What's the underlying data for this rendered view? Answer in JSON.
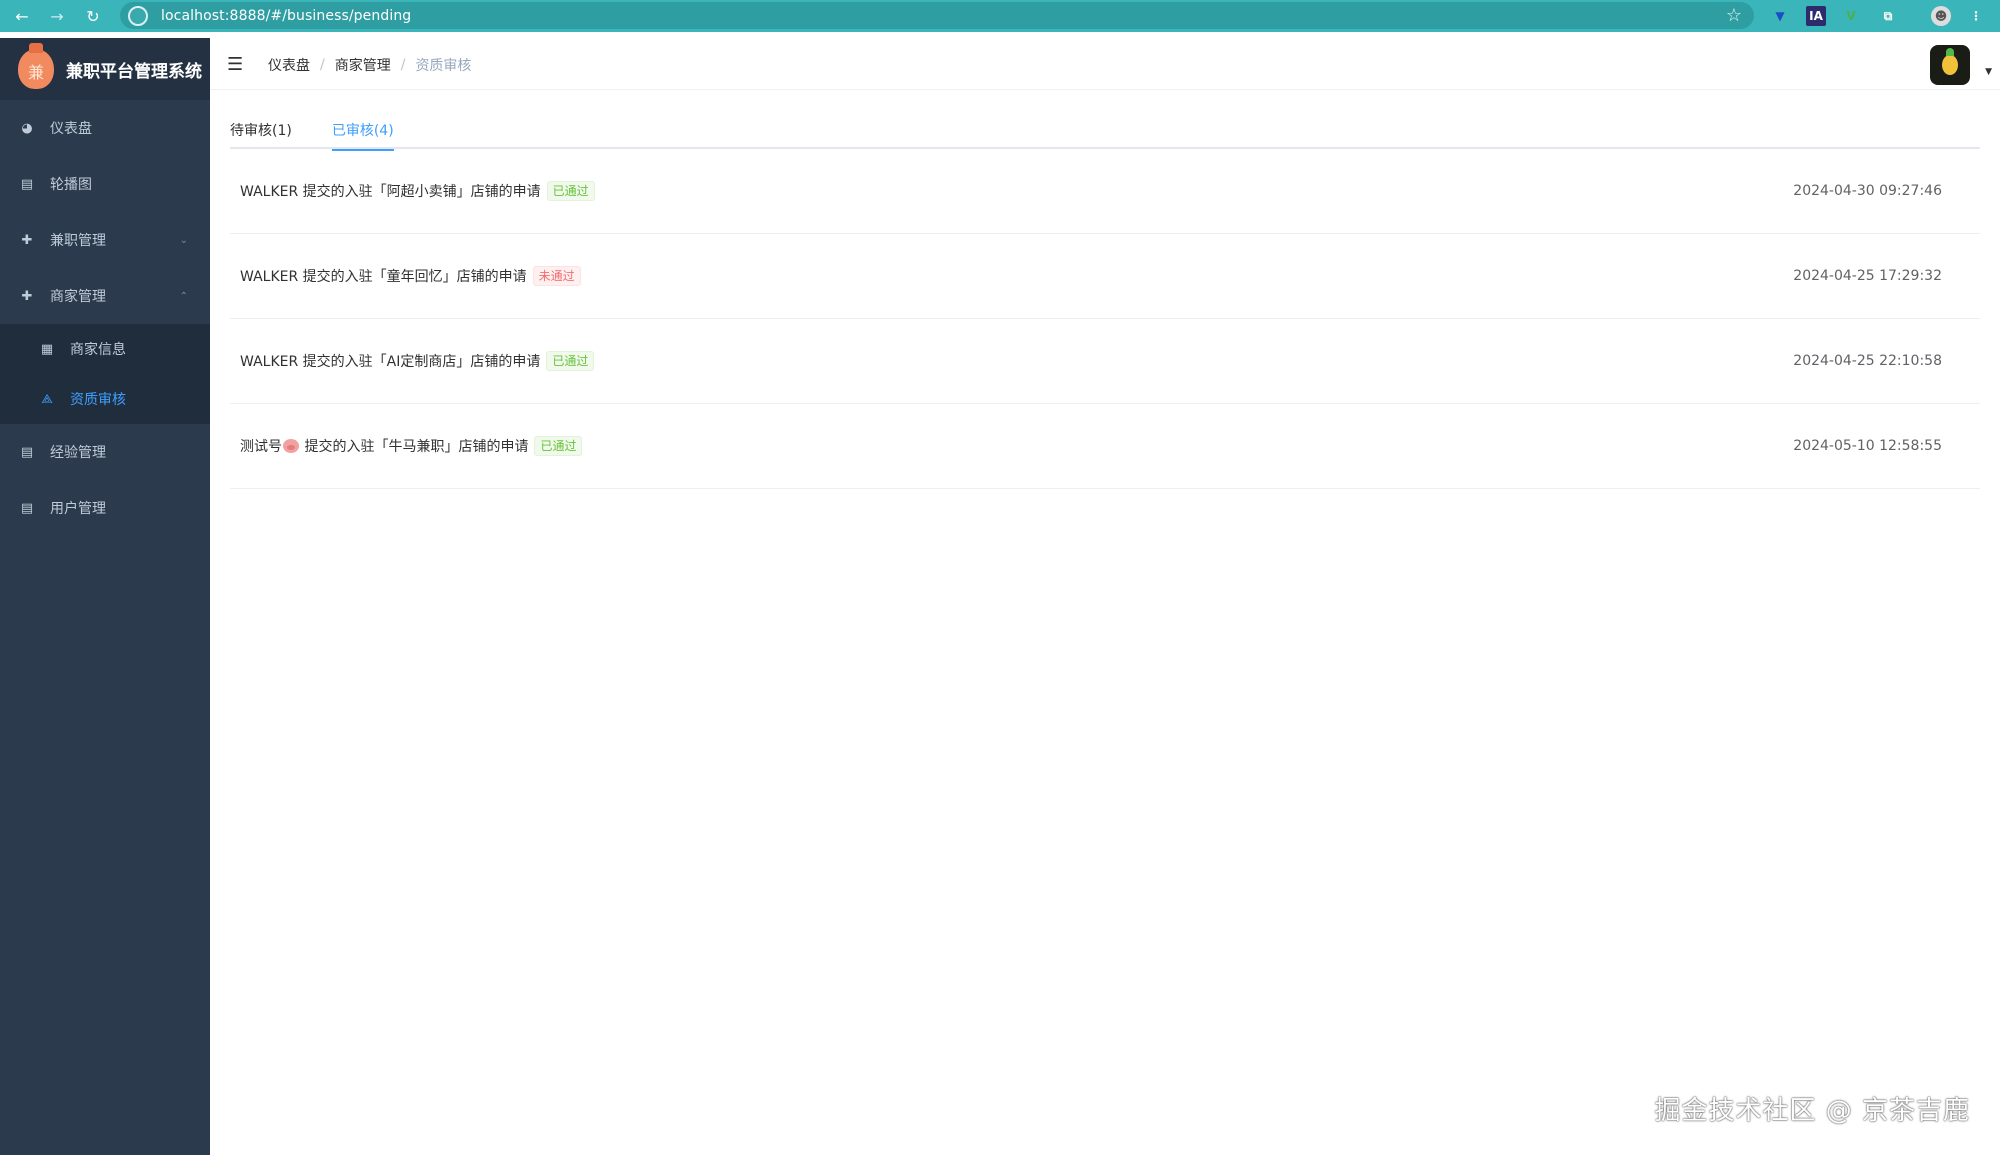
{
  "browser": {
    "url": "localhost:8888/#/business/pending",
    "back_icon": "arrow-left-icon",
    "forward_icon": "arrow-right-icon",
    "reload_icon": "reload-icon",
    "ext_ia_label": "IA",
    "ext_v_label": "V"
  },
  "sidebar": {
    "brand_logo_text": "兼",
    "brand_title": "兼职平台管理系统",
    "items": [
      {
        "label": "仪表盘",
        "icon": "dashboard-icon"
      },
      {
        "label": "轮播图",
        "icon": "document-icon"
      },
      {
        "label": "兼职管理",
        "icon": "plus-circle-icon"
      },
      {
        "label": "商家管理",
        "icon": "plus-circle-icon"
      },
      {
        "label": "经验管理",
        "icon": "document-icon"
      },
      {
        "label": "用户管理",
        "icon": "document-icon"
      }
    ],
    "subitems": [
      {
        "label": "商家信息",
        "icon": "grid-icon"
      },
      {
        "label": "资质审核",
        "icon": "tree-icon"
      }
    ]
  },
  "header": {
    "breadcrumb": [
      "仪表盘",
      "商家管理",
      "资质审核"
    ]
  },
  "tabs": [
    {
      "label": "待审核(1)"
    },
    {
      "label": "已审核(4)"
    }
  ],
  "rows": [
    {
      "title": "WALKER 提交的入驻「阿超小卖铺」店铺的申请",
      "status": "已通过",
      "time": "2024-04-30 09:27:46"
    },
    {
      "title": "WALKER 提交的入驻「童年回忆」店铺的申请",
      "status": "未通过",
      "time": "2024-04-25 17:29:32"
    },
    {
      "title": "WALKER 提交的入驻「AI定制商店」店铺的申请",
      "status": "已通过",
      "time": "2024-04-25 22:10:58"
    },
    {
      "title_prefix": "测试号",
      "title_suffix": " 提交的入驻「牛马兼职」店铺的申请",
      "status": "已通过",
      "time": "2024-05-10 12:58:55"
    }
  ],
  "colors": {
    "browser_bar": "#3ab5b9",
    "sidebar_bg": "#2b3a4c",
    "active_blue": "#409eff",
    "pass_green": "#67c23a",
    "fail_red": "#f56c6c"
  },
  "watermark": "掘金技术社区 @ 京茶吉鹿"
}
